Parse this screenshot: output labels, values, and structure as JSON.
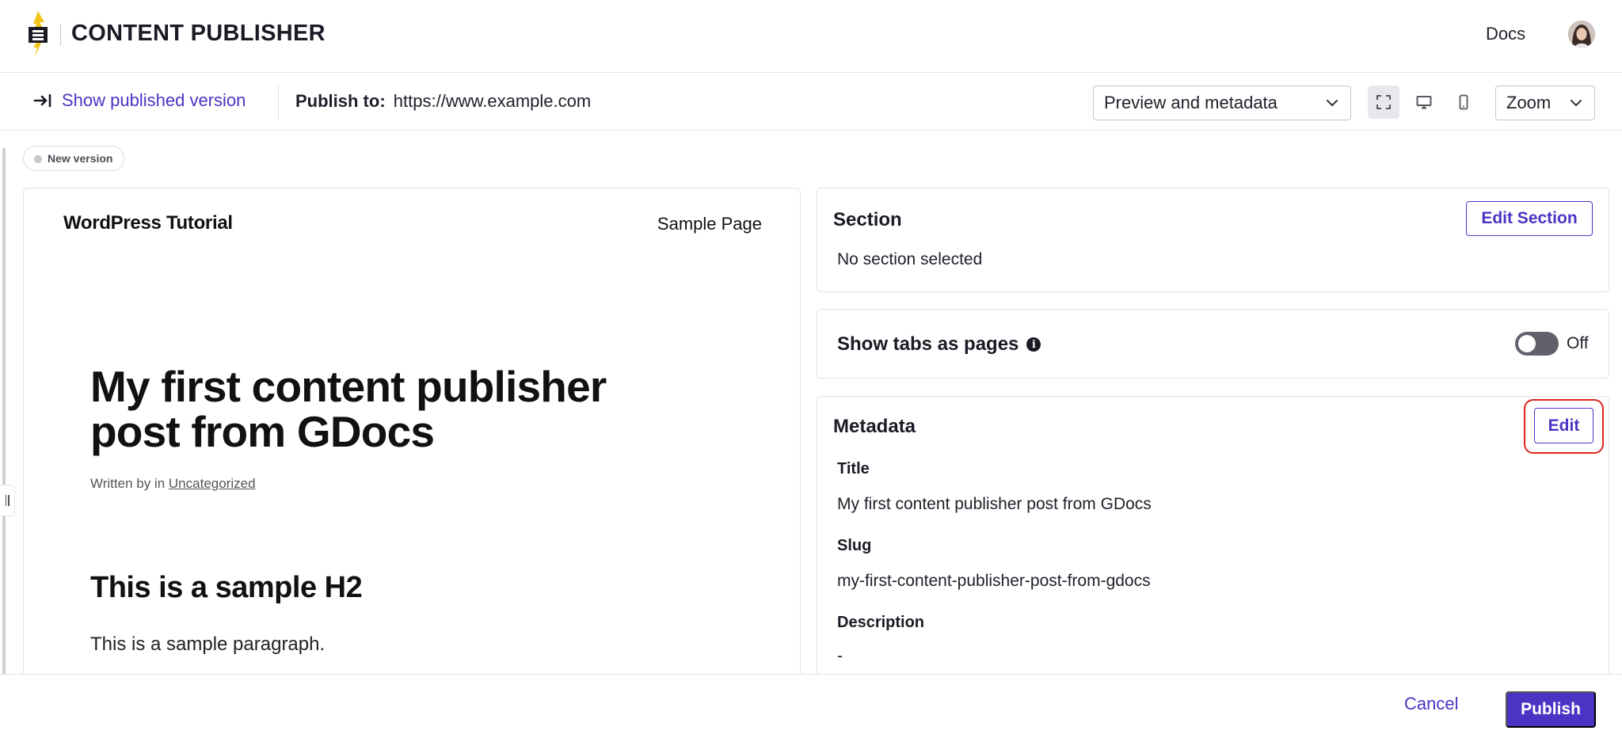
{
  "app": {
    "title": "CONTENT PUBLISHER",
    "docs_label": "Docs",
    "logo_icon": "lightning-logo-icon",
    "brand_color": "#4a34c4"
  },
  "toolbar": {
    "show_published_label": "Show published version",
    "publish_to_label": "Publish to:",
    "publish_to_url": "https://www.example.com",
    "view_select_value": "Preview and metadata",
    "zoom_select_value": "Zoom",
    "view_modes": [
      "fullscreen-icon",
      "desktop-icon",
      "mobile-icon"
    ],
    "active_view_mode": "fullscreen-icon"
  },
  "version_badge": "New version",
  "preview": {
    "site_title": "WordPress Tutorial",
    "nav_item": "Sample Page",
    "post_title": "My first content publisher post from GDocs",
    "meta_prefix": "Written by in",
    "meta_category": "Uncategorized",
    "h2": "This is a sample H2",
    "paragraph": "This is a sample paragraph."
  },
  "section_card": {
    "title": "Section",
    "edit_label": "Edit Section",
    "empty_text": "No section selected"
  },
  "tabs_card": {
    "label": "Show tabs as pages",
    "toggle_state": "Off"
  },
  "metadata_card": {
    "title": "Metadata",
    "edit_label": "Edit",
    "fields": [
      {
        "label": "Title",
        "value": "My first content publisher post from GDocs"
      },
      {
        "label": "Slug",
        "value": "my-first-content-publisher-post-from-gdocs"
      },
      {
        "label": "Description",
        "value": "-"
      }
    ]
  },
  "actions": {
    "cancel_label": "Cancel",
    "publish_label": "Publish"
  }
}
